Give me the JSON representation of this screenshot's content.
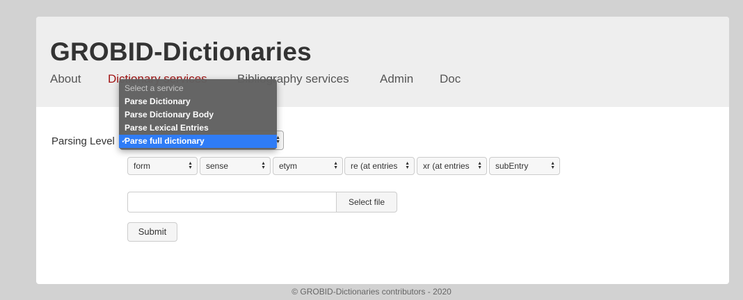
{
  "header": {
    "title": "GROBID-Dictionaries",
    "nav": {
      "about": "About",
      "dictionary_services": "Dictionary services",
      "bibliography_services": "Bibliography services",
      "admin": "Admin",
      "doc": "Doc"
    }
  },
  "form": {
    "parsing_level_label": "Parsing Level",
    "selects": {
      "form": "form",
      "sense": "sense",
      "etym": "etym",
      "re": "re (at entries",
      "xr": "xr (at entries",
      "subentry": "subEntry"
    },
    "file_input_value": "",
    "select_file_label": "Select file",
    "submit_label": "Submit"
  },
  "dropdown": {
    "placeholder": "Select a service",
    "options": [
      "Parse Dictionary",
      "Parse Dictionary Body",
      "Parse Lexical Entries",
      "Parse full dictionary"
    ],
    "selected": "Parse full dictionary",
    "check_mark": "✓"
  },
  "footer": "© GROBID-Dictionaries contributors - 2020",
  "colors": {
    "accent": "#a31515",
    "selection": "#2f7cf6",
    "background": "#d2d2d2",
    "header": "#eeeeee"
  }
}
